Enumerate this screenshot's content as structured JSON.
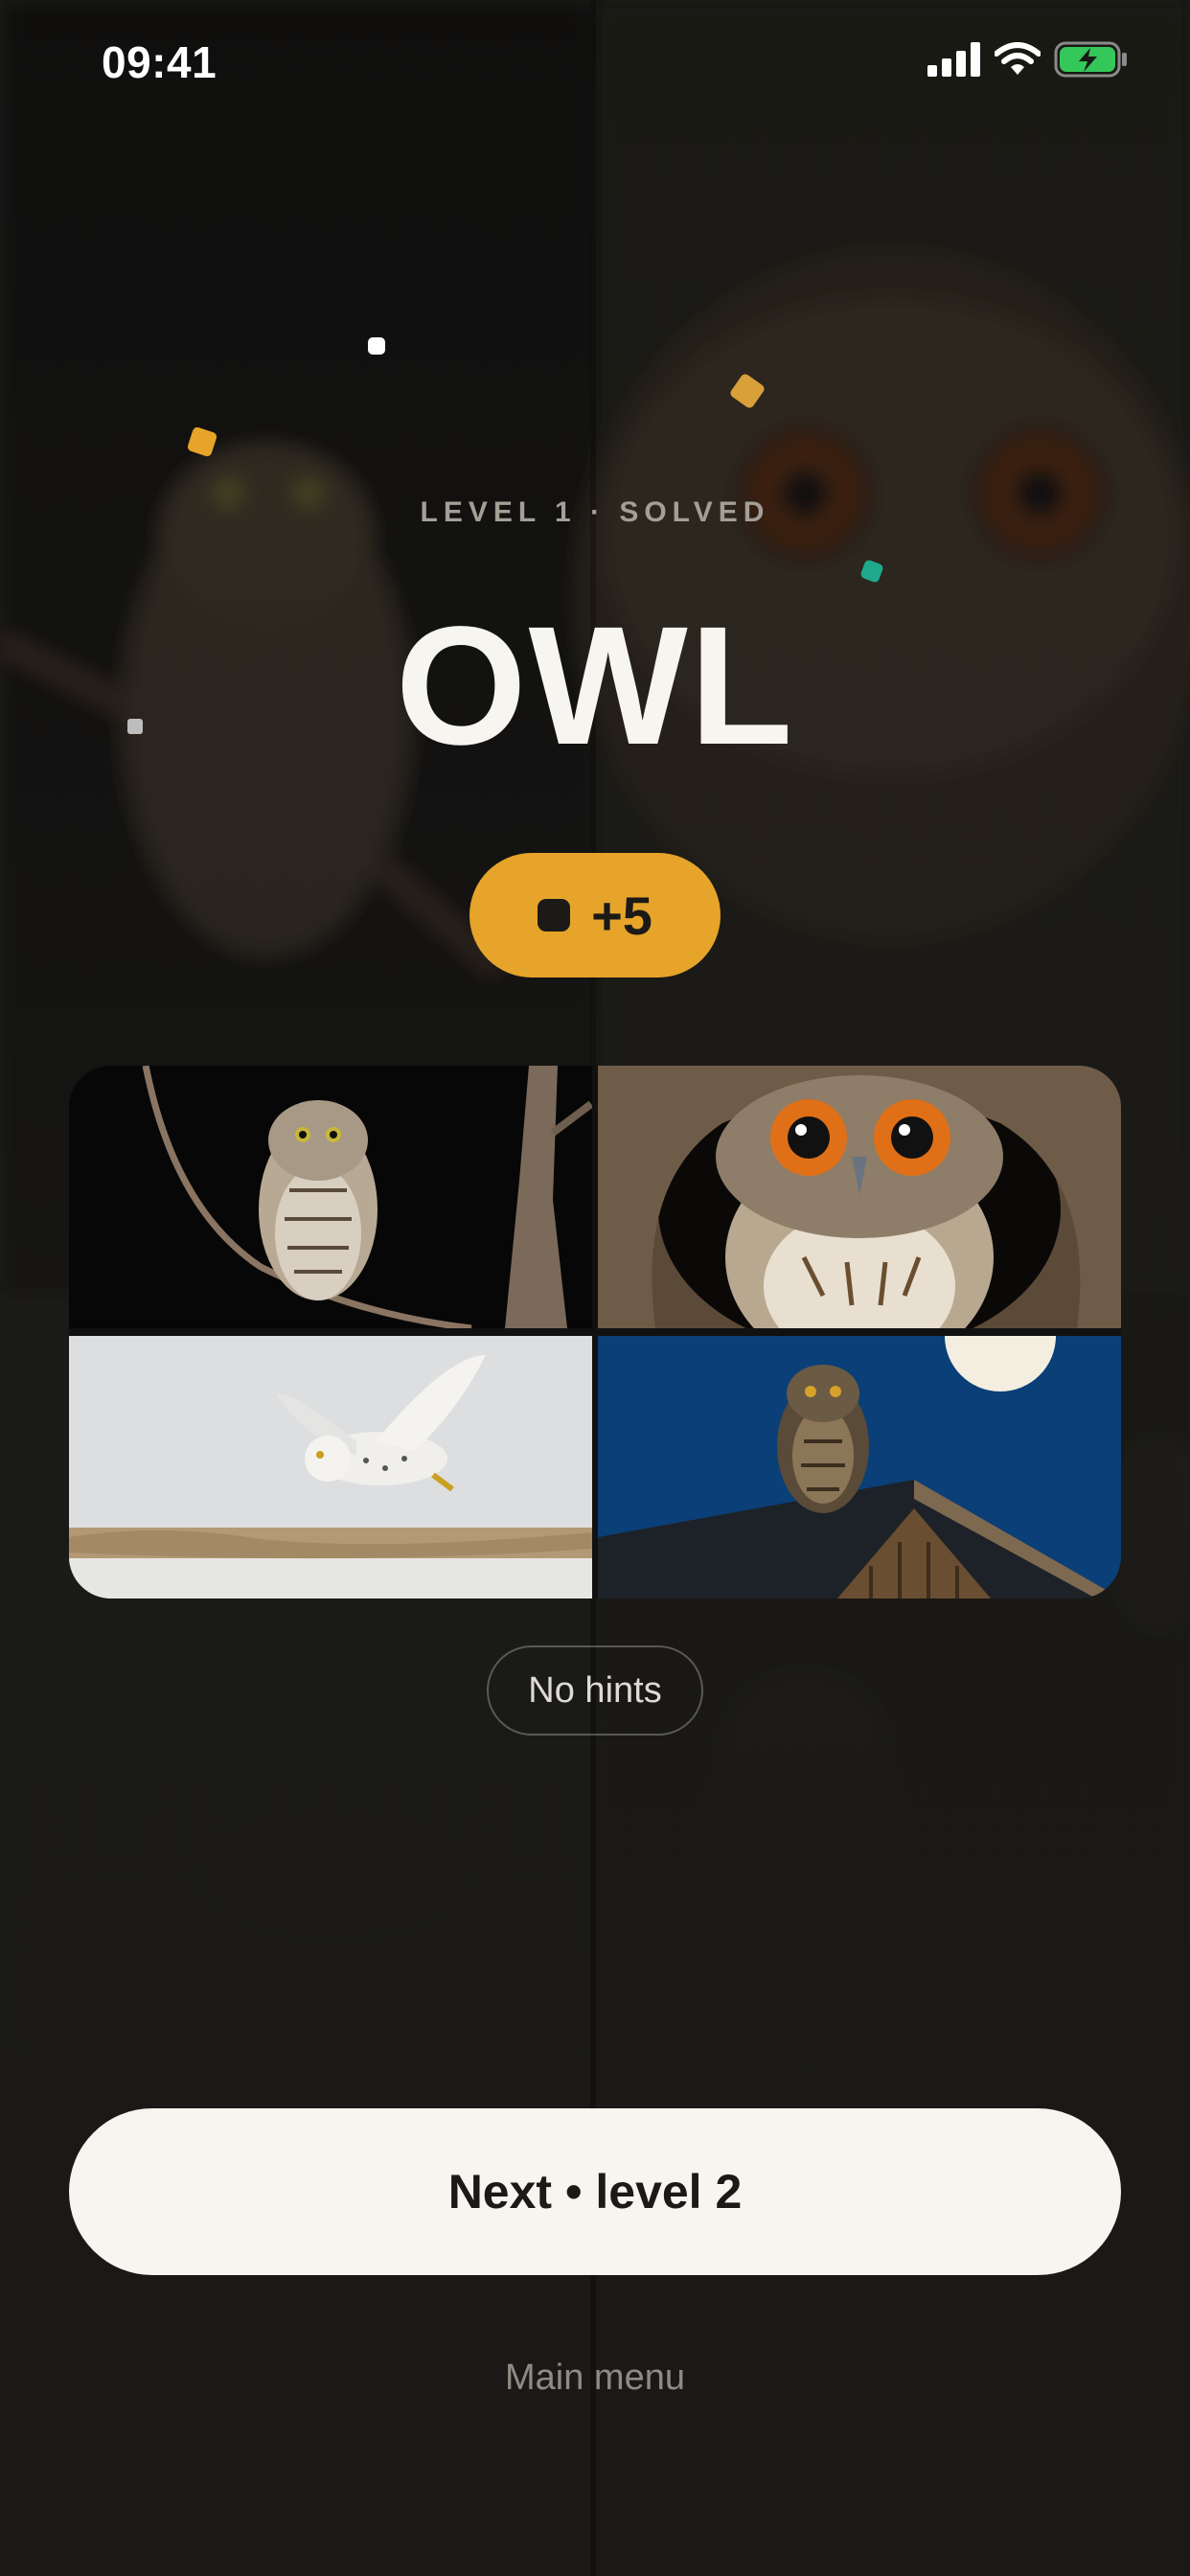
{
  "status_bar": {
    "time": "09:41",
    "icons": [
      "cellular-signal-icon",
      "wifi-icon",
      "battery-charging-icon"
    ],
    "battery_color": "#34c759"
  },
  "result": {
    "level_label": "LEVEL 1 · SOLVED",
    "answer": "OWL",
    "reward": "+5",
    "reward_color": "#e6a42a"
  },
  "photos": [
    "barred-owl-on-branch",
    "owl-in-tree-hollow",
    "snowy-owl-flying",
    "owl-on-roof-under-moon"
  ],
  "hints": {
    "label": "No hints"
  },
  "actions": {
    "next_label": "Next • level 2",
    "main_menu_label": "Main menu"
  },
  "colors": {
    "background": "#1a1917",
    "accent": "#e6a42a",
    "confetti": [
      "#ffffff",
      "#e6a42a",
      "#d9a03a",
      "#1fa88c",
      "#bdbdbd"
    ]
  }
}
